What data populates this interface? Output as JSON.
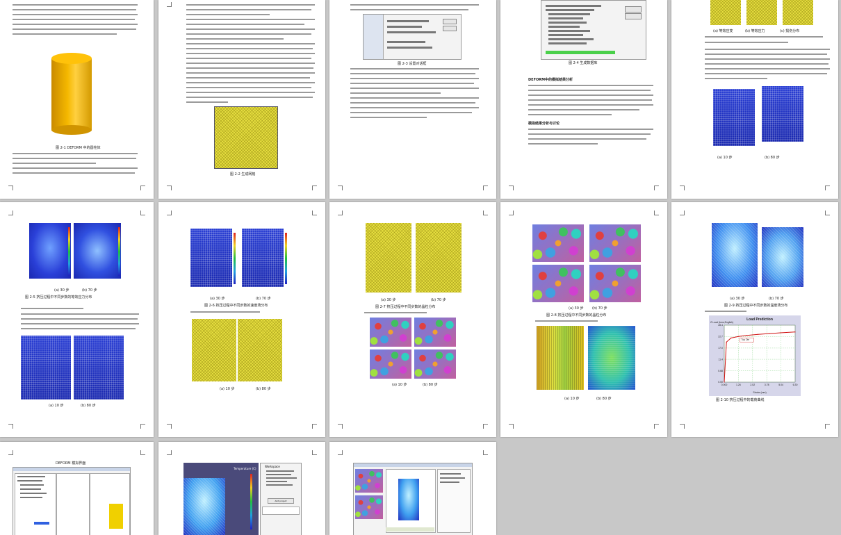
{
  "pages": [
    {
      "id": "p1",
      "captions": [
        "图 2-1  DEFORM 中的圆柱体"
      ]
    },
    {
      "id": "p2",
      "captions": [
        "图 2-2  生成网格"
      ]
    },
    {
      "id": "p3",
      "captions": [
        "图 2-3  设置对话框"
      ]
    },
    {
      "id": "p4",
      "captions": [
        "图 2-4 生成数据库",
        "DEFORM中的模拟结果分析",
        "模拟结果分析与讨论"
      ]
    },
    {
      "id": "p5",
      "captions": [
        "(a) 等效应变",
        "(b) 等效应力",
        "(c) 损伤分布",
        "(a) 10 步",
        "(b) 80 步"
      ]
    },
    {
      "id": "p6",
      "captions": [
        "(a) 30 步",
        "(b) 70 步",
        "图 2-5  挤压过程中不同步数的等效应力分布",
        "(a) 10 步",
        "(b) 80 步"
      ]
    },
    {
      "id": "p7",
      "captions": [
        "(a) 30 步",
        "(b) 70 步",
        "图 2-6  挤压过程中不同步数的速度场分布",
        "(a) 10 步",
        "(b) 80 步"
      ]
    },
    {
      "id": "p8",
      "captions": [
        "(a) 30 步",
        "(b) 70 步",
        "图 2-7  挤压过程中不同步数的晶粒分布",
        "(a) 10 步",
        "(b) 80 步"
      ]
    },
    {
      "id": "p9",
      "captions": [
        "(a) 30 步",
        "(b) 70 步",
        "图 2-8  挤压过程中不同步数的晶粒分布",
        "(a) 10 步",
        "(b) 80 步"
      ]
    },
    {
      "id": "p10",
      "captions": [
        "(a) 30 步",
        "(b) 70 步",
        "图 2-9  挤压过程中不同步数的温度场分布",
        "图 2-10  挤压过程中的载荷曲线"
      ]
    },
    {
      "id": "p11",
      "captions": [
        "DEFORM 模拟界面"
      ]
    },
    {
      "id": "p12",
      "captions": []
    },
    {
      "id": "p13",
      "captions": []
    }
  ],
  "chart_data": {
    "type": "line",
    "title": "Load Prediction",
    "ylabel": "Z Load (tons,English)",
    "xlabel": "Stroke (mm)",
    "x_ticks": [
      "0.000",
      "1.26",
      "2.52",
      "3.78",
      "5.04",
      "6.30"
    ],
    "y_ticks": [
      "0.00",
      "5.68",
      "11.4",
      "17.0",
      "22.7",
      "28.4"
    ],
    "xlim": [
      0,
      6.3
    ],
    "ylim": [
      0,
      28.4
    ],
    "series": [
      {
        "name": "Top Die",
        "x": [
          0,
          0.2,
          0.6,
          1.26,
          2.0,
          3.0,
          4.0,
          5.0,
          6.3
        ],
        "y": [
          0,
          20.0,
          22.0,
          22.8,
          23.3,
          23.8,
          24.2,
          24.6,
          25.0
        ]
      }
    ],
    "annotation": "Top Die",
    "grid": true
  },
  "ui_labels": {
    "workspace": "Workspace",
    "add_project": "Add project",
    "temperature_label": "Temperature (C)"
  }
}
